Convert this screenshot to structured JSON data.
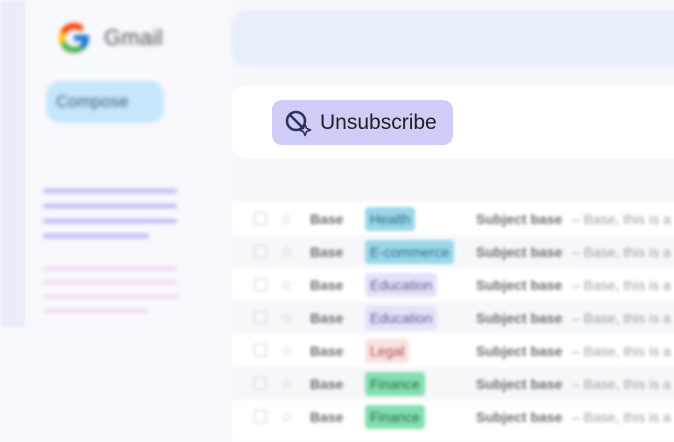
{
  "app": {
    "brand": "Gmail",
    "compose_label": "Compose",
    "unsubscribe_label": "Unsubscribe"
  },
  "colors": {
    "compose_bg": "#c6e6fb",
    "unsubscribe_bg": "#cdcdf7",
    "accent_purple": "#b3b2f3"
  },
  "icons": {
    "logo": "google-g-icon",
    "unsubscribe": "magic-unsubscribe-icon",
    "checkbox": "checkbox-icon",
    "star": "star-icon"
  },
  "emails": [
    {
      "sender": "Base",
      "tag": "Health",
      "tag_bg": "#9bd7ea",
      "tag_fg": "#2a6b80",
      "subject": "Subject base",
      "snippet": "– Base, this is a"
    },
    {
      "sender": "Base",
      "tag": "E-commerce",
      "tag_bg": "#9bd7ea",
      "tag_fg": "#2a6b80",
      "subject": "Subject base",
      "snippet": "– Base, this is a"
    },
    {
      "sender": "Base",
      "tag": "Education",
      "tag_bg": "#e3e2fb",
      "tag_fg": "#5c5b8a",
      "subject": "Subject base",
      "snippet": "– Base, this is a"
    },
    {
      "sender": "Base",
      "tag": "Education",
      "tag_bg": "#e3e2fb",
      "tag_fg": "#5c5b8a",
      "subject": "Subject base",
      "snippet": "– Base, this is a"
    },
    {
      "sender": "Base",
      "tag": "Legal",
      "tag_bg": "#fbe0e0",
      "tag_fg": "#a05050",
      "subject": "Subject base",
      "snippet": "– Base, this is a"
    },
    {
      "sender": "Base",
      "tag": "Finance",
      "tag_bg": "#84dfb0",
      "tag_fg": "#1f6b45",
      "subject": "Subject base",
      "snippet": "– Base, this is a"
    },
    {
      "sender": "Base",
      "tag": "Finance",
      "tag_bg": "#84dfb0",
      "tag_fg": "#1f6b45",
      "subject": "Subject base",
      "snippet": "– Base, this is a"
    }
  ]
}
